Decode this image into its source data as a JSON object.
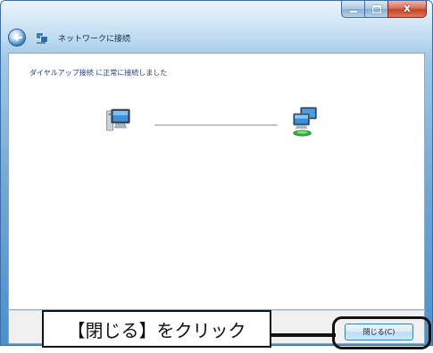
{
  "window": {
    "title": "ネットワークに接続",
    "caption_buttons": {
      "minimize_icon": "minimize-icon",
      "maximize_icon": "maximize-icon",
      "close_label": "x"
    }
  },
  "content": {
    "status_message": "ダイヤルアップ接続 に正常に接続しました"
  },
  "footer": {
    "close_button_label": "閉じる(C)"
  },
  "annotation": {
    "callout_text": "【閉じる】をクリック"
  },
  "colors": {
    "frame_blue": "#4b8fcb",
    "status_text": "#1f3d75",
    "button_border": "#3c7fb1",
    "callout_black": "#111111"
  },
  "icons": {
    "back": "back-arrow-icon",
    "network": "network-icon",
    "computer": "computer-icon",
    "connected_network": "network-computers-icon"
  }
}
